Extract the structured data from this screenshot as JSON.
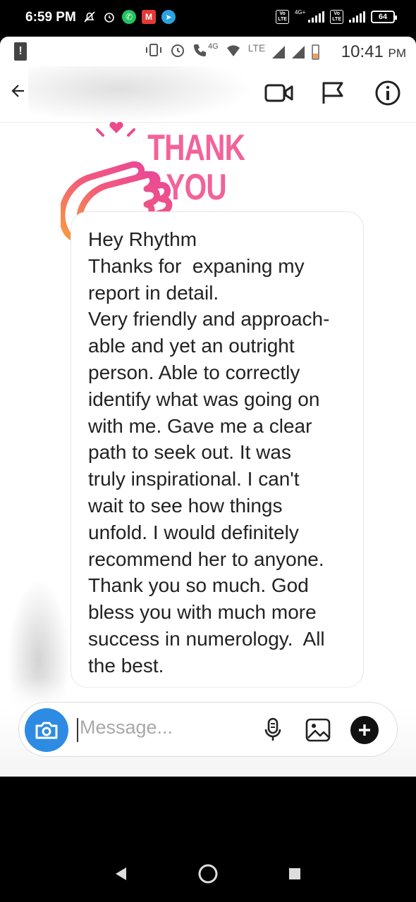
{
  "outer_status": {
    "time": "6:59 PM",
    "battery": "64",
    "volte_label": "Vo\nLTE",
    "network": "4G+"
  },
  "inner_status": {
    "network": "4G",
    "carrier": "LTE",
    "time": "10:41",
    "ampm": "PM"
  },
  "header": {
    "back_icon": "back-arrow-icon",
    "video_icon": "video-call-icon",
    "flag_icon": "report-flag-icon",
    "info_icon": "info-icon"
  },
  "sticker": {
    "line1": "THANK",
    "line2": "YOU"
  },
  "message": {
    "lines": [
      "Hey Rhythm",
      "Thanks for  expaning my",
      "report in detail.",
      "Very friendly and approach-",
      "able and yet an outright",
      "person. Able to correctly",
      "identify what was going on",
      "with me. Gave me a clear",
      "path to seek out. It was",
      "truly inspirational. I can't",
      "wait to see how things",
      "unfold. I would definitely",
      "recommend her to anyone.",
      "Thank you so much. God",
      "bless you with much more",
      "success in numerology.  All",
      "the best."
    ]
  },
  "composer": {
    "placeholder": "Message...",
    "camera_icon": "camera-icon",
    "mic_icon": "microphone-icon",
    "gallery_icon": "gallery-icon",
    "plus_icon": "plus-icon"
  },
  "colors": {
    "accent_blue": "#2e8be3",
    "sticker_pink": "#f3629a",
    "sticker_orange": "#f7a23a"
  }
}
